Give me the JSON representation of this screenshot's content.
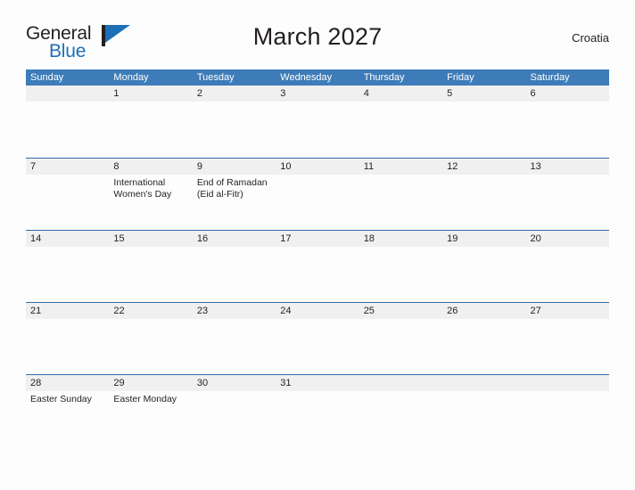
{
  "brand": {
    "name_part1": "General",
    "name_part2": "Blue",
    "flag_icon": "flag-triangle-icon"
  },
  "header": {
    "title": "March 2027",
    "region": "Croatia"
  },
  "colors": {
    "header_blue": "#3d7cb8",
    "row_rule_blue": "#2e6da4",
    "band_gray": "#f0f0f0",
    "brand_blue": "#1d6fb8",
    "page_background": "#fdfdfd",
    "text": "#231f20"
  },
  "weekdays": [
    "Sunday",
    "Monday",
    "Tuesday",
    "Wednesday",
    "Thursday",
    "Friday",
    "Saturday"
  ],
  "weeks": [
    {
      "days": [
        {
          "date": "",
          "events": []
        },
        {
          "date": "1",
          "events": []
        },
        {
          "date": "2",
          "events": []
        },
        {
          "date": "3",
          "events": []
        },
        {
          "date": "4",
          "events": []
        },
        {
          "date": "5",
          "events": []
        },
        {
          "date": "6",
          "events": []
        }
      ]
    },
    {
      "days": [
        {
          "date": "7",
          "events": []
        },
        {
          "date": "8",
          "events": [
            "International",
            "Women's Day"
          ]
        },
        {
          "date": "9",
          "events": [
            "End of Ramadan",
            "(Eid al-Fitr)"
          ]
        },
        {
          "date": "10",
          "events": []
        },
        {
          "date": "11",
          "events": []
        },
        {
          "date": "12",
          "events": []
        },
        {
          "date": "13",
          "events": []
        }
      ]
    },
    {
      "days": [
        {
          "date": "14",
          "events": []
        },
        {
          "date": "15",
          "events": []
        },
        {
          "date": "16",
          "events": []
        },
        {
          "date": "17",
          "events": []
        },
        {
          "date": "18",
          "events": []
        },
        {
          "date": "19",
          "events": []
        },
        {
          "date": "20",
          "events": []
        }
      ]
    },
    {
      "days": [
        {
          "date": "21",
          "events": []
        },
        {
          "date": "22",
          "events": []
        },
        {
          "date": "23",
          "events": []
        },
        {
          "date": "24",
          "events": []
        },
        {
          "date": "25",
          "events": []
        },
        {
          "date": "26",
          "events": []
        },
        {
          "date": "27",
          "events": []
        }
      ]
    },
    {
      "days": [
        {
          "date": "28",
          "events": [
            "Easter Sunday"
          ]
        },
        {
          "date": "29",
          "events": [
            "Easter Monday"
          ]
        },
        {
          "date": "30",
          "events": []
        },
        {
          "date": "31",
          "events": []
        },
        {
          "date": "",
          "events": []
        },
        {
          "date": "",
          "events": []
        },
        {
          "date": "",
          "events": []
        }
      ]
    }
  ]
}
